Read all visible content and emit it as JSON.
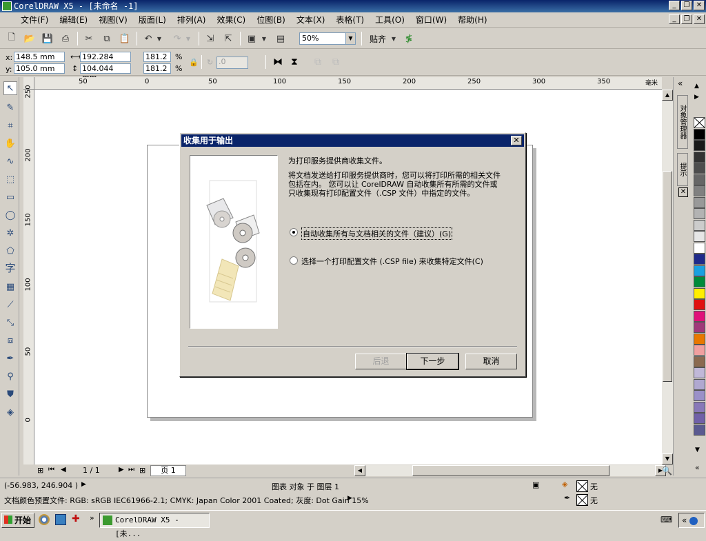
{
  "window": {
    "title": "CorelDRAW X5 - [未命名 -1]"
  },
  "menu": [
    "文件(F)",
    "编辑(E)",
    "视图(V)",
    "版面(L)",
    "排列(A)",
    "效果(C)",
    "位图(B)",
    "文本(X)",
    "表格(T)",
    "工具(O)",
    "窗口(W)",
    "帮助(H)"
  ],
  "toolbar": {
    "zoom": "50%",
    "snap_label": "贴齐"
  },
  "props": {
    "x": "148.5 mm",
    "y": "105.0 mm",
    "w": "192.284 mm",
    "h": "104.044 mm",
    "sx": "181.2",
    "sy": "181.2",
    "x_label": "x:",
    "y_label": "y:",
    "pct": "%",
    "angle": ".0"
  },
  "ruler": {
    "h_ticks": [
      "50",
      "0",
      "50",
      "100",
      "150",
      "200",
      "250",
      "300",
      "350"
    ],
    "v_ticks": [
      "250",
      "200",
      "150",
      "100",
      "50",
      "0"
    ],
    "unit": "毫米"
  },
  "page_nav": {
    "count": "1 / 1",
    "tab": "页 1"
  },
  "status": {
    "coords": "(-56.983, 246.904 )",
    "object": "图表 对象 于 图层 1",
    "fill_label": "无",
    "outline_label": "无",
    "color_profile": "文档颜色预置文件: RGB: sRGB IEC61966-2.1; CMYK: Japan Color 2001 Coated; 灰度: Dot Gain 15%"
  },
  "taskbar": {
    "start": "开始",
    "task": "CorelDRAW X5 - [未..."
  },
  "dialog": {
    "title": "收集用于输出",
    "heading": "为打印服务提供商收集文件。",
    "body": "将文档发送给打印服务提供商时，您可以将打印所需的相关文件包括在内。 您可以让 CorelDRAW 自动收集所有所需的文件或只收集现有打印配置文件（.CSP 文件）中指定的文件。",
    "option1": "自动收集所有与文档相关的文件（建议）(G)",
    "option2": "选择一个打印配置文件 (.CSP file) 来收集特定文件(C)",
    "back": "后退",
    "next": "下一步",
    "cancel": "取消"
  },
  "docker": {
    "tab1": "对象管理器",
    "tab2": "提示"
  },
  "palette": [
    "#ffffff",
    "#000000",
    "#1a1a1a",
    "#333333",
    "#4d4d4d",
    "#666666",
    "#808080",
    "#999999",
    "#b3b3b3",
    "#cccccc",
    "#e6e6e6",
    "#ffffff",
    "#1f2a8a",
    "#1aa0e0",
    "#008a3a",
    "#ffee00",
    "#e01010",
    "#e0107a",
    "#a0387a",
    "#e87800",
    "#f0a0a0",
    "#8a6a50",
    "#c0b8d8",
    "#b0a8d0",
    "#9a90c8",
    "#8878b8",
    "#7060a8",
    "#5a5a90"
  ]
}
